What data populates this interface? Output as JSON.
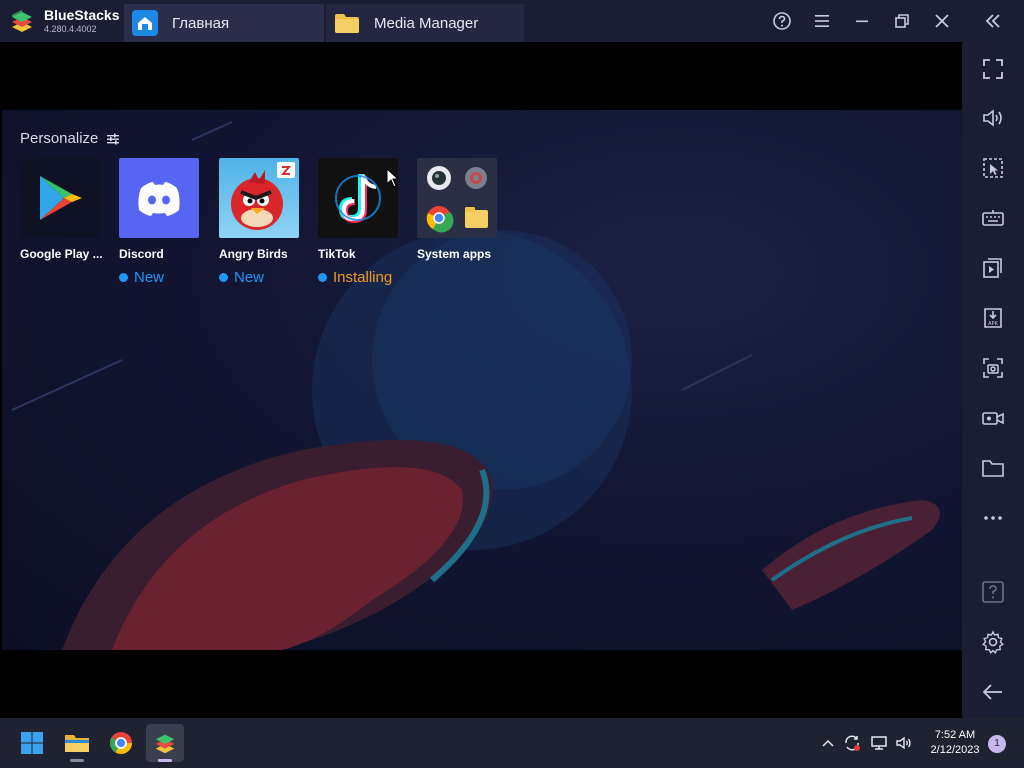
{
  "titlebar": {
    "app_name": "BlueStacks",
    "version": "4.280.4.4002",
    "tabs": [
      {
        "label": "Главная",
        "icon": "home-icon"
      },
      {
        "label": "Media Manager",
        "icon": "folder-icon"
      }
    ],
    "controls": [
      "help-icon",
      "menu-icon",
      "minimize-icon",
      "restore-icon",
      "close-icon",
      "collapse-sidebar-icon"
    ]
  },
  "home": {
    "section_title": "Personalize",
    "apps": [
      {
        "name": "Google Play ...",
        "status": "",
        "icon": "google-play-icon"
      },
      {
        "name": "Discord",
        "status": "New",
        "icon": "discord-icon"
      },
      {
        "name": "Angry Birds",
        "status": "New",
        "icon": "angry-birds-icon"
      },
      {
        "name": "TikTok",
        "status": "Installing",
        "icon": "tiktok-icon"
      },
      {
        "name": "System apps",
        "status": "",
        "icon": "system-apps-icon"
      }
    ]
  },
  "sidebar": {
    "buttons": [
      "fullscreen-icon",
      "volume-icon",
      "select-icon",
      "keyboard-icon",
      "media-icon",
      "apk-install-icon",
      "screenshot-icon",
      "record-video-icon",
      "folder-icon",
      "more-icon",
      "help-icon",
      "settings-icon",
      "back-icon"
    ]
  },
  "taskbar": {
    "time": "7:52 AM",
    "date": "2/12/2023",
    "notification_count": "1"
  },
  "colors": {
    "accent_blue": "#2196f3",
    "installing_orange": "#f39a1e",
    "titlebar_bg": "#1a1d33",
    "discord": "#5865f2"
  }
}
